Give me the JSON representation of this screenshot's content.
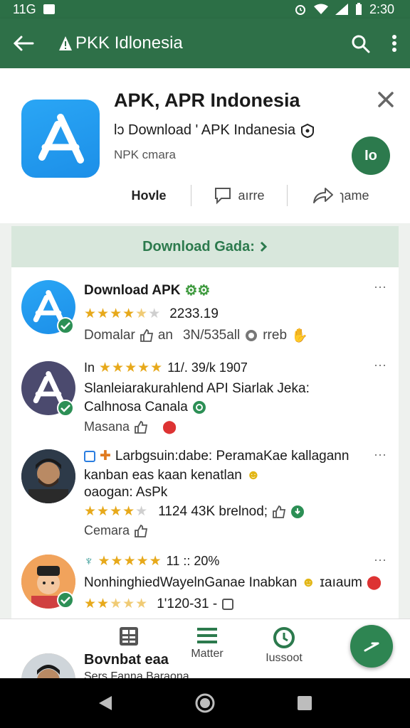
{
  "status": {
    "network": "11G",
    "time": "2:30"
  },
  "appbar": {
    "title": "PKK Idlonesia"
  },
  "header": {
    "app_title": "APK, APR Indonesia",
    "subtitle": "lɔ Download ' APK Indanesia",
    "developer": "NPK cmara",
    "green_button": "Io",
    "actions": [
      "Hovle",
      "aırre",
      "ɿame"
    ]
  },
  "banner": {
    "label": "Download Gada:"
  },
  "items": [
    {
      "title": "Download APK",
      "rating_text": "2233.19",
      "meta1": "Domalar",
      "meta2": "an",
      "meta3": "3N/535all",
      "meta4": "rreb"
    },
    {
      "line1_prefix": "In",
      "line1_rest": "11/. 39/k 1907",
      "line2": "Slanleiarakurahlend API Siarlak Jeka:",
      "line3": "Calhnosa Canala",
      "line4": "Masana"
    },
    {
      "line1": "Larbgsuin:dabe: PeramaKae kallagann",
      "line2": "kanban eas kaan kenatlan",
      "line3": "oaogan: AsPk",
      "line4": "1124 43K brelnod;",
      "line5": "Cemara"
    },
    {
      "line1": "11 :: 20%",
      "line2": "NonhinghiedWayelnGanae Inabkan",
      "line3": "1'120-31 -",
      "line3_suffix": "ɪaıaum"
    }
  ],
  "bottomnav": {
    "items": [
      "",
      "Matter",
      "Iussoot"
    ],
    "peek_title": "Bovnbat eaa",
    "peek_sub": "Sers Fanna Baraona"
  },
  "colors": {
    "primary": "#2e7048",
    "accent": "#2c7a4d",
    "star": "#e7a91b"
  }
}
